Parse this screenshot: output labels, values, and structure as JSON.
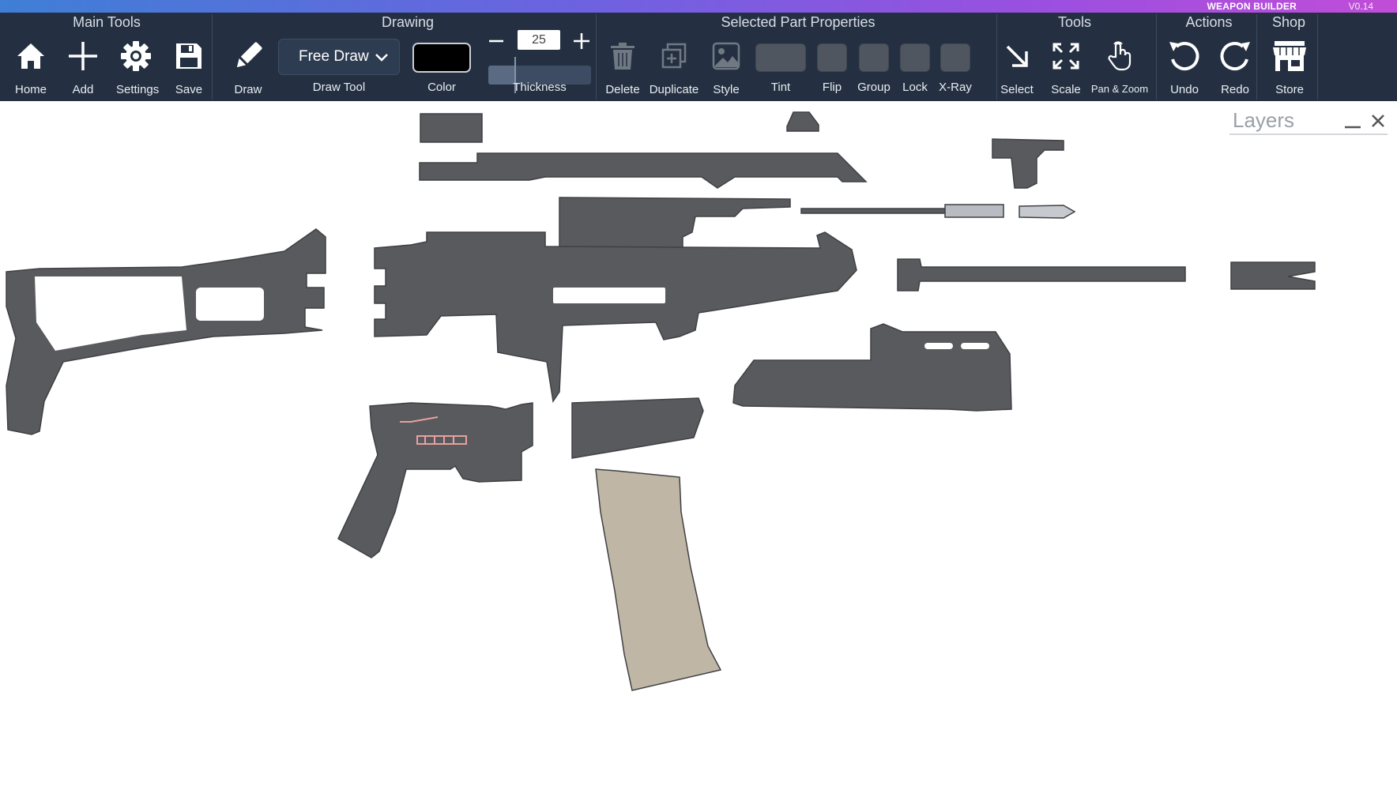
{
  "app": {
    "name": "WEAPON BUILDER",
    "version": "V0.14"
  },
  "groups": {
    "main_tools": "Main Tools",
    "drawing": "Drawing",
    "selected_part_properties": "Selected Part Properties",
    "tools": "Tools",
    "actions": "Actions",
    "shop": "Shop"
  },
  "main_tools": [
    {
      "label": "Home",
      "icon": "home-icon"
    },
    {
      "label": "Add",
      "icon": "plus-icon"
    },
    {
      "label": "Settings",
      "icon": "gear-icon"
    },
    {
      "label": "Save",
      "icon": "floppy-disk-icon"
    }
  ],
  "drawing": {
    "draw_label": "Draw",
    "draw_tool_value": "Free Draw",
    "draw_tool_label": "Draw Tool",
    "color_label": "Color",
    "color_value": "#000000",
    "thickness_label": "Thickness",
    "thickness_value": "25",
    "thickness_fraction": 0.25
  },
  "part_properties": [
    {
      "label": "Delete",
      "icon": "trash-icon"
    },
    {
      "label": "Duplicate",
      "icon": "duplicate-icon"
    },
    {
      "label": "Style",
      "icon": "image-style-icon"
    },
    {
      "label": "Tint"
    },
    {
      "label": "Flip"
    },
    {
      "label": "Group"
    },
    {
      "label": "Lock"
    },
    {
      "label": "X-Ray"
    }
  ],
  "tools": [
    {
      "label": "Select",
      "icon": "select-arrow-icon"
    },
    {
      "label": "Scale",
      "icon": "scale-arrows-icon"
    },
    {
      "label": "Pan & Zoom",
      "icon": "hand-pointer-icon"
    }
  ],
  "actions": [
    {
      "label": "Undo",
      "icon": "undo-icon"
    },
    {
      "label": "Redo",
      "icon": "redo-icon"
    }
  ],
  "shop": {
    "label": "Store",
    "icon": "store-icon"
  },
  "layers": {
    "title": "Layers"
  },
  "colors": {
    "toolbar_bg": "#243041",
    "part_gray": "#5a5c5f",
    "accent_gradient_start": "#3f7fd6",
    "accent_gradient_end": "#c04dd8"
  }
}
